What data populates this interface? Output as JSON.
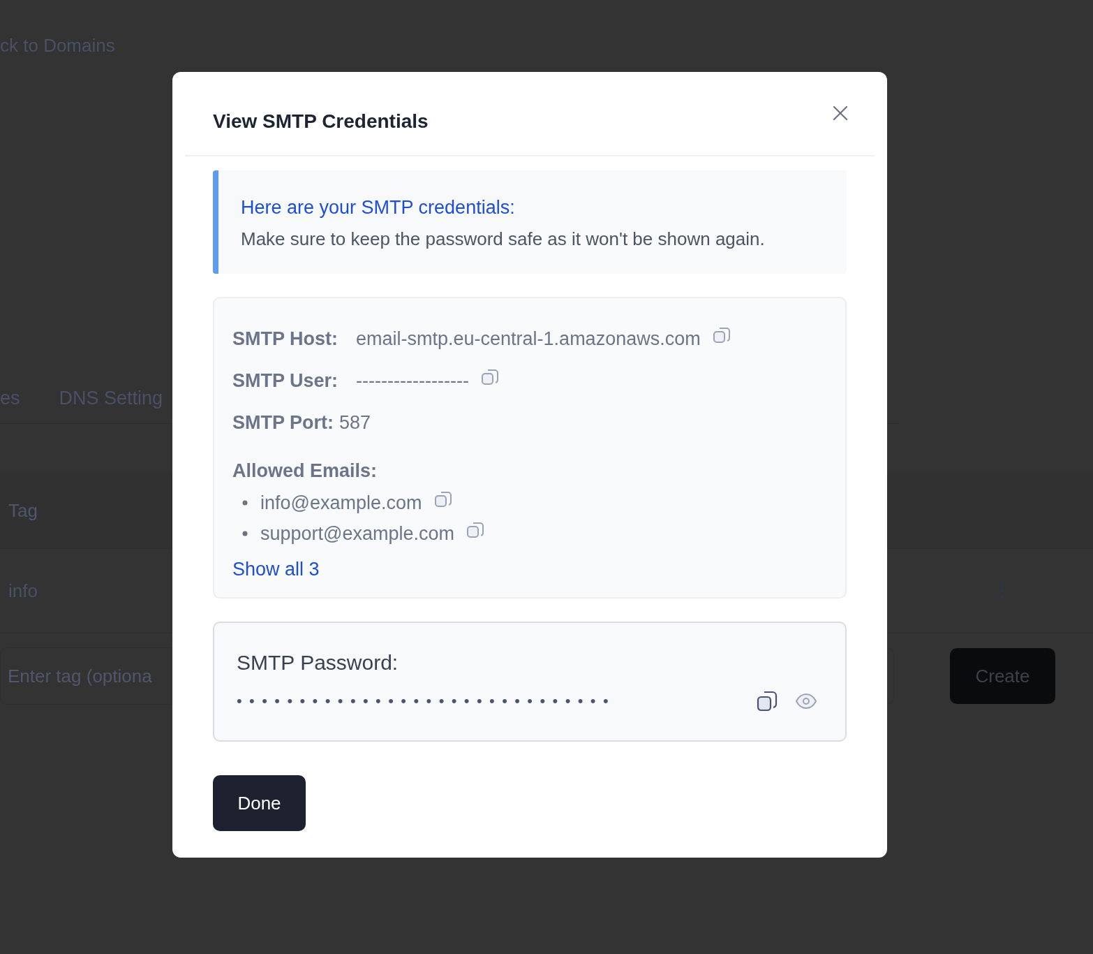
{
  "background_page": {
    "back_link": "ck to Domains",
    "tabs": [
      "es",
      "DNS Setting"
    ],
    "table_header": "Tag",
    "table_cell": "info",
    "tag_input": {
      "placeholder": "Enter tag (optiona"
    },
    "create_button": "Create"
  },
  "modal": {
    "title": "View SMTP Credentials",
    "notice": {
      "title": "Here are your SMTP credentials:",
      "text": "Make sure to keep the password safe as it won't be shown again."
    },
    "fields": [
      {
        "label": "SMTP Host:",
        "value": "email-smtp.eu-central-1.amazonaws.com",
        "copyable": true
      },
      {
        "label": "SMTP User:",
        "value": "------------------",
        "copyable": true
      },
      {
        "label": "SMTP Port:",
        "value": "587",
        "copyable": false
      }
    ],
    "allowed_emails": {
      "label": "Allowed Emails:",
      "items": [
        "info@example.com",
        "support@example.com"
      ],
      "show_all": "Show all 3"
    },
    "password": {
      "label": "SMTP Password:",
      "value": "••••••••••••••••••••••••••••••"
    },
    "done_button": "Done"
  }
}
